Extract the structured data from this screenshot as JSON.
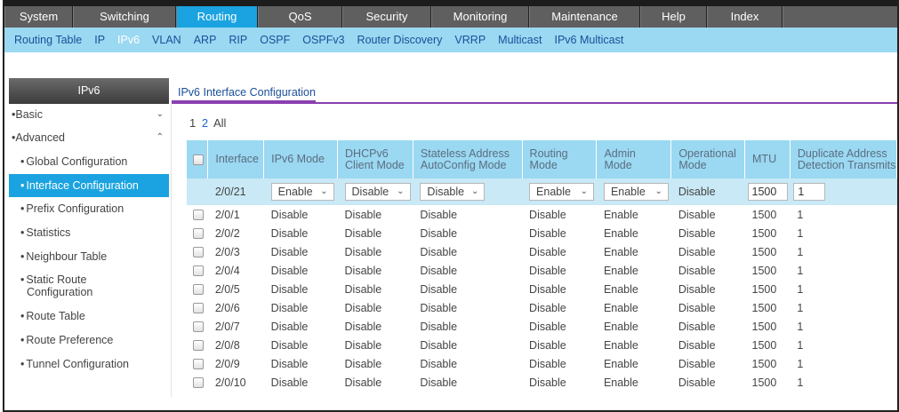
{
  "top_nav": [
    {
      "label": "System",
      "active": false
    },
    {
      "label": "Switching",
      "active": false
    },
    {
      "label": "Routing",
      "active": true
    },
    {
      "label": "QoS",
      "active": false
    },
    {
      "label": "Security",
      "active": false
    },
    {
      "label": "Monitoring",
      "active": false
    },
    {
      "label": "Maintenance",
      "active": false
    },
    {
      "label": "Help",
      "active": false
    },
    {
      "label": "Index",
      "active": false
    }
  ],
  "sub_nav": [
    {
      "label": "Routing Table",
      "active": false
    },
    {
      "label": "IP",
      "active": false
    },
    {
      "label": "IPv6",
      "active": true
    },
    {
      "label": "VLAN",
      "active": false
    },
    {
      "label": "ARP",
      "active": false
    },
    {
      "label": "RIP",
      "active": false
    },
    {
      "label": "OSPF",
      "active": false
    },
    {
      "label": "OSPFv3",
      "active": false
    },
    {
      "label": "Router Discovery",
      "active": false
    },
    {
      "label": "VRRP",
      "active": false
    },
    {
      "label": "Multicast",
      "active": false
    },
    {
      "label": "IPv6 Multicast",
      "active": false
    }
  ],
  "sidebar": {
    "title": "IPv6",
    "basic": {
      "label": "Basic",
      "chevron": "chevron-down-icon"
    },
    "advanced": {
      "label": "Advanced",
      "chevron": "chevron-up-icon"
    },
    "items": [
      {
        "label": "Global Configuration",
        "active": false
      },
      {
        "label": "Interface Configuration",
        "active": true
      },
      {
        "label": "Prefix Configuration",
        "active": false
      },
      {
        "label": "Statistics",
        "active": false
      },
      {
        "label": "Neighbour Table",
        "active": false
      },
      {
        "label": "Static Route",
        "label2": "Configuration",
        "active": false
      },
      {
        "label": "Route Table",
        "active": false
      },
      {
        "label": "Route Preference",
        "active": false
      },
      {
        "label": "Tunnel Configuration",
        "active": false
      }
    ]
  },
  "main": {
    "title": "IPv6 Interface Configuration",
    "pager": {
      "pages": [
        "1",
        "2"
      ],
      "all": "All",
      "current": "1"
    },
    "columns": [
      {
        "line1": "Interface",
        "line2": ""
      },
      {
        "line1": "IPv6 Mode",
        "line2": ""
      },
      {
        "line1": "DHCPv6",
        "line2": "Client Mode"
      },
      {
        "line1": "Stateless Address",
        "line2": "AutoConfig Mode"
      },
      {
        "line1": "Routing",
        "line2": "Mode"
      },
      {
        "line1": "Admin",
        "line2": "Mode"
      },
      {
        "line1": "Operational",
        "line2": "Mode"
      },
      {
        "line1": "MTU",
        "line2": ""
      },
      {
        "line1": "Duplicate Address",
        "line2": "Detection Transmits"
      }
    ],
    "edit_row": {
      "interface": "2/0/21",
      "ipv6_mode": "Enable",
      "dhcpv6_client_mode": "Disable",
      "stateless_autoconfig": "Disable",
      "routing_mode": "Enable",
      "admin_mode": "Enable",
      "operational_mode": "Disable",
      "mtu": "1500",
      "dad_transmits": "1"
    },
    "rows": [
      [
        "2/0/1",
        "Disable",
        "Disable",
        "Disable",
        "Disable",
        "Enable",
        "Disable",
        "1500",
        "1"
      ],
      [
        "2/0/2",
        "Disable",
        "Disable",
        "Disable",
        "Disable",
        "Enable",
        "Disable",
        "1500",
        "1"
      ],
      [
        "2/0/3",
        "Disable",
        "Disable",
        "Disable",
        "Disable",
        "Enable",
        "Disable",
        "1500",
        "1"
      ],
      [
        "2/0/4",
        "Disable",
        "Disable",
        "Disable",
        "Disable",
        "Enable",
        "Disable",
        "1500",
        "1"
      ],
      [
        "2/0/5",
        "Disable",
        "Disable",
        "Disable",
        "Disable",
        "Enable",
        "Disable",
        "1500",
        "1"
      ],
      [
        "2/0/6",
        "Disable",
        "Disable",
        "Disable",
        "Disable",
        "Enable",
        "Disable",
        "1500",
        "1"
      ],
      [
        "2/0/7",
        "Disable",
        "Disable",
        "Disable",
        "Disable",
        "Enable",
        "Disable",
        "1500",
        "1"
      ],
      [
        "2/0/8",
        "Disable",
        "Disable",
        "Disable",
        "Disable",
        "Enable",
        "Disable",
        "1500",
        "1"
      ],
      [
        "2/0/9",
        "Disable",
        "Disable",
        "Disable",
        "Disable",
        "Enable",
        "Disable",
        "1500",
        "1"
      ],
      [
        "2/0/10",
        "Disable",
        "Disable",
        "Disable",
        "Disable",
        "Enable",
        "Disable",
        "1500",
        "1"
      ]
    ]
  },
  "colors": {
    "accent": "#1aa3e0",
    "subnav_bg": "#9bd8f2",
    "edit_row_bg": "#c9e9f6",
    "title_rule": "#8a3fb0",
    "topnav_bg": "#5f5f5f"
  }
}
